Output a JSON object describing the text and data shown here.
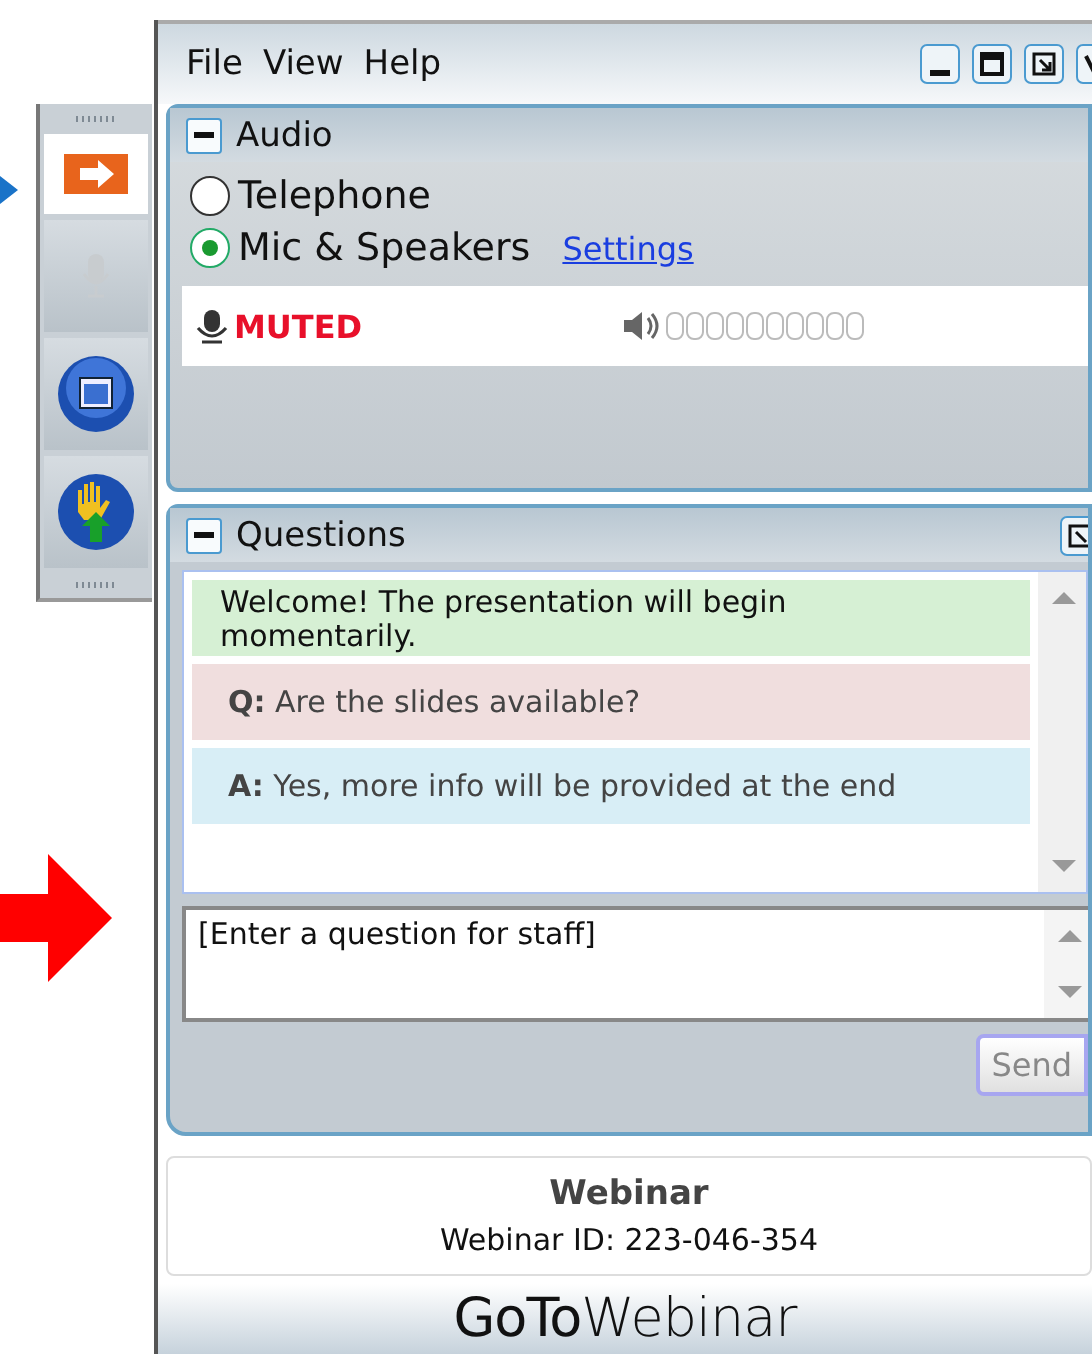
{
  "menu": [
    "File",
    "View",
    "Help"
  ],
  "toolbar": [
    {
      "kind": "arrow",
      "selected": true
    },
    {
      "kind": "mic",
      "selected": false
    },
    {
      "kind": "screen",
      "selected": false
    },
    {
      "kind": "hand",
      "selected": false
    }
  ],
  "audio": {
    "title": "Audio",
    "expanded": true,
    "options": [
      {
        "label": "Telephone",
        "selected": false
      },
      {
        "label": "Mic & Speakers",
        "selected": true
      }
    ],
    "settings_link": "Settings",
    "mic_status": "MUTED"
  },
  "questions": {
    "title": "Questions",
    "expanded": true,
    "messages": [
      {
        "kind": "notice",
        "text": "Welcome!  The presentation  will begin momentarily."
      },
      {
        "kind": "question",
        "text": "**Q:** Are the slides available?"
      },
      {
        "kind": "answer",
        "text": "**A:** Yes, more info will be provided at the end"
      }
    ],
    "input": {
      "placeholder": "[Enter a question for staff]"
    },
    "send_button": "Send"
  },
  "footer": {
    "title": "Webinar",
    "webinar_id": "Webinar ID: 223-046-354",
    "logo": "**GoTo**Webinar"
  }
}
